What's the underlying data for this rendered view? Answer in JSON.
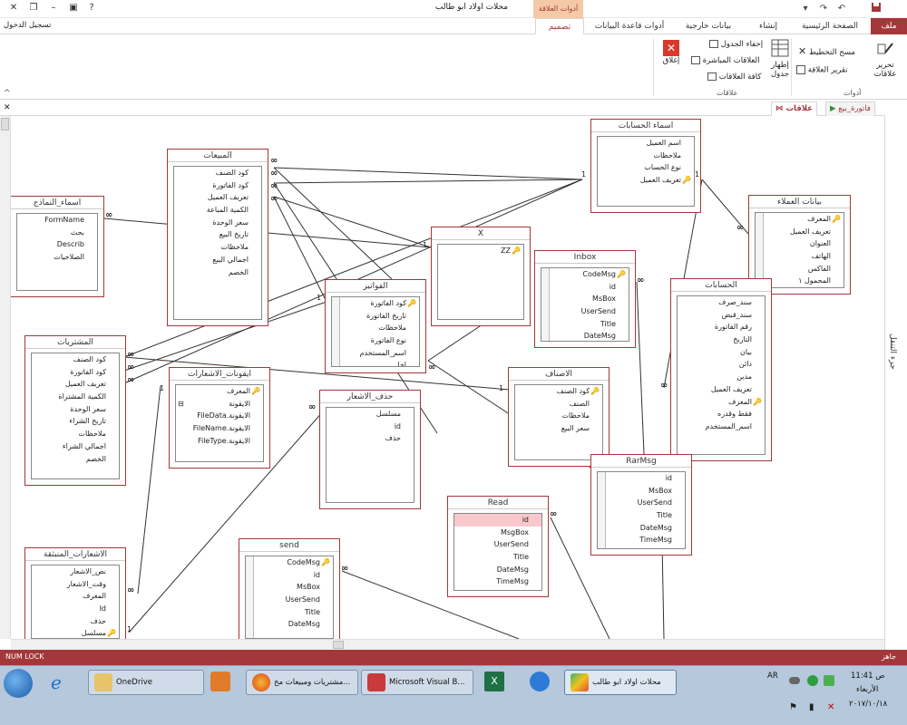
{
  "titlebar": {
    "title": "محلات اولاد ابو طالب",
    "context_tab": "أدوات العلاقة",
    "sign_in": "تسجيل الدخول"
  },
  "tabs": {
    "file": "ملف",
    "home": "الصفحة الرئيسية",
    "create": "إنشاء",
    "external": "بيانات خارجية",
    "dbtools": "أدوات قاعدة البيانات",
    "design": "تصميم"
  },
  "ribbon": {
    "edit_relationships": "تحرير علاقات",
    "clear_layout": "مسح التخطيط",
    "relationship_report": "تقرير العلاقة",
    "tools_group": "أدوات",
    "show_table": "إظهار جدول",
    "hide_table": "إخفاء الجدول",
    "direct_relationships": "العلاقات المباشرة",
    "all_relationships": "كافة العلاقات",
    "close": "إغلاق",
    "relationships_group": "علاقات"
  },
  "doc_tabs": {
    "relationships": "علاقات",
    "sales_invoice": "فاتورة_بيع"
  },
  "nav_pane": {
    "label": "جزء التنقل"
  },
  "tables": {
    "mabieat": {
      "title": "المبيعات",
      "fields": [
        "كود الصنف",
        "كود الفاتورة",
        "تعريف العميل",
        "الكمية المباعة",
        "سعر الوحدة",
        "تاريخ البيع",
        "ملاحظات",
        "اجمالي البيع",
        "الخصم"
      ]
    },
    "asmaa_namazij": {
      "title": "اسماء_النماذج",
      "fields": [
        "FormName",
        "بحث",
        "Describ",
        "الصلاحيات"
      ]
    },
    "asmaa_hisabat": {
      "title": "اسماء الحسابات",
      "fields": [
        "اسم العميل",
        "ملاحظات",
        "نوع الحساب",
        "تعريف العميل"
      ]
    },
    "x": {
      "title": "X",
      "fields": [
        "ZZ"
      ]
    },
    "inbox": {
      "title": "Inbox",
      "fields": [
        "CodeMsg",
        "id",
        "MsBox",
        "UserSend",
        "Title",
        "DateMsg"
      ]
    },
    "bayanat_omalaa": {
      "title": "بيانات العملاء",
      "fields": [
        "المعرف",
        "تعريف العميل",
        "العنوان",
        "الهاتف",
        "الفاكس",
        "المحمول ١"
      ]
    },
    "fawatir": {
      "title": "الفواتير",
      "fields": [
        "كود الفاتورة",
        "تاريخ الفاتورة",
        "ملاحظات",
        "نوع الفاتورة",
        "اسم_المستخدم",
        "اجل"
      ]
    },
    "hisabat": {
      "title": "الحسابات",
      "fields": [
        "سند_صرف",
        "سند_قبض",
        "رقم الفاتورة",
        "التاريخ",
        "بيان",
        "دائن",
        "مدين",
        "تعريف العميل",
        "المعرف",
        "فقط وقدره",
        "اسم_المستخدم"
      ]
    },
    "mushtarayat": {
      "title": "المشتريات",
      "fields": [
        "كود الصنف",
        "كود الفاتورة",
        "تعريف العميل",
        "الكمية المشتراة",
        "سعر الوحدة",
        "تاريخ الشراء",
        "ملاحظات",
        "اجمالي الشراء",
        "الخصم"
      ]
    },
    "iconat": {
      "title": "ايقونات_الاشعارات",
      "fields": [
        "المعرف",
        "الايقونة",
        "FileData.الايقونة",
        "FileName.الايقونة",
        "FileType.الايقونة"
      ]
    },
    "hathf_ashaar": {
      "title": "حذف_الاشعار",
      "fields": [
        "مسلسل",
        "id",
        "حذف"
      ]
    },
    "asnaf": {
      "title": "الاصناف",
      "fields": [
        "كود الصنف",
        "الصنف",
        "ملاحظات",
        "سعر البيع"
      ]
    },
    "rarmsg": {
      "title": "RarMsg",
      "fields": [
        "id",
        "MsBox",
        "UserSend",
        "Title",
        "DateMsg",
        "TimeMsg"
      ]
    },
    "read": {
      "title": "Read",
      "fields": [
        "id",
        "MsgBox",
        "UserSend",
        "Title",
        "DateMsg",
        "TimeMsg"
      ]
    },
    "send": {
      "title": "send",
      "fields": [
        "CodeMsg",
        "id",
        "MsBox",
        "UserSend",
        "Title",
        "DateMsg"
      ]
    },
    "ashaarat_munbathiqa": {
      "title": "الاشعارات_المنبثقة",
      "fields": [
        "نص_الاشعار",
        "وقت_الاشعار",
        "المعرف",
        "Id",
        "حذف",
        "مسلسل"
      ]
    }
  },
  "relationship_labels": {
    "one": "1",
    "many": "∞"
  },
  "statusbar": {
    "left": "NUM LOCK",
    "right": "جاهز"
  },
  "taskbar": {
    "onedrive": "OneDrive",
    "firefox_window": "مشتريات ومبيعات مخ...",
    "vb_window": "Microsoft Visual B...",
    "access_window": "محلات اولاد ابو طالب",
    "lang": "AR",
    "time": "11:41 ص",
    "day": "الأربعاء",
    "date": "٢٠١٧/١٠/١٨"
  }
}
